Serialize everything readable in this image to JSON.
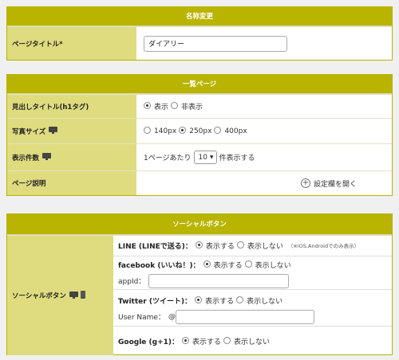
{
  "name_panel": {
    "header": "名称変更",
    "page_title_label": "ページタイトル*",
    "page_title_value": "ダイアリー"
  },
  "list_panel": {
    "header": "一覧ページ",
    "heading_title_label": "見出しタイトル(h1タグ)",
    "heading_title_options": [
      "表示",
      "非表示"
    ],
    "heading_title_selected": "表示",
    "photo_size_label": "写真サイズ",
    "photo_size_icon": "monitor-icon",
    "photo_size_options": [
      "140px",
      "250px",
      "400px"
    ],
    "photo_size_selected": "250px",
    "display_count_label": "表示件数",
    "display_count_icon": "monitor-icon",
    "display_count_prefix": "1ページあたり",
    "display_count_value": "10",
    "display_count_suffix": "件表示する",
    "page_desc_label": "ページ説明",
    "page_desc_expand": "設定欄を開く"
  },
  "social_panel": {
    "header": "ソーシャルボタン",
    "label": "ソーシャルボタン",
    "icons": [
      "monitor-icon",
      "smartphone-icon"
    ],
    "show": "表示する",
    "hide": "表示しない",
    "line": {
      "name": "LINE (LINEで送る)：",
      "selected": "表示する",
      "note": "（※iOS,Androidでのみ表示）"
    },
    "facebook": {
      "name": "facebook (いいね！)：",
      "selected": "表示する",
      "appid_label": "appId：",
      "appid_value": ""
    },
    "twitter": {
      "name": "Twitter (ツイート)：",
      "selected": "表示する",
      "username_label": "User Name：",
      "at": "@",
      "username_value": ""
    },
    "google": {
      "name": "Google (g+1)：",
      "selected": "表示する"
    }
  }
}
